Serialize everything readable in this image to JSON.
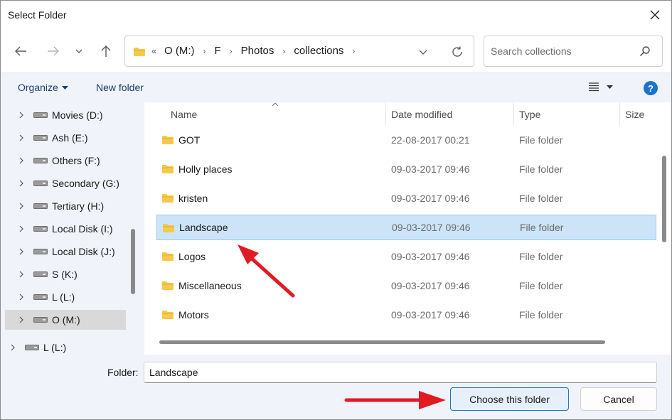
{
  "window": {
    "title": "Select Folder"
  },
  "nav": {
    "back_icon": "arrow-left-icon",
    "forward_icon": "arrow-right-icon",
    "recent_icon": "chevron-down-icon",
    "up_icon": "arrow-up-icon"
  },
  "address": {
    "overflow": "«",
    "crumbs": [
      "O (M:)",
      "F",
      "Photos",
      "collections"
    ]
  },
  "search": {
    "placeholder": "Search collections"
  },
  "commands": {
    "organize": "Organize",
    "new_folder": "New folder",
    "help": "?"
  },
  "sidebar": {
    "items": [
      {
        "label": "Movies (D:)"
      },
      {
        "label": "Ash (E:)"
      },
      {
        "label": "Others (F:)"
      },
      {
        "label": "Secondary (G:)"
      },
      {
        "label": "Tertiary (H:)"
      },
      {
        "label": "Local Disk (I:)"
      },
      {
        "label": "Local Disk (J:)"
      },
      {
        "label": "S (K:)"
      },
      {
        "label": "L (L:)"
      },
      {
        "label": "O (M:)"
      },
      {
        "label": "L (L:)"
      }
    ],
    "selected": "O (M:)"
  },
  "columns": {
    "name": "Name",
    "date": "Date modified",
    "type": "Type",
    "size": "Size"
  },
  "files": [
    {
      "name": "GOT",
      "date": "22-08-2017 00:21",
      "type": "File folder"
    },
    {
      "name": "Holly places",
      "date": "09-03-2017 09:46",
      "type": "File folder"
    },
    {
      "name": "kristen",
      "date": "09-03-2017 09:46",
      "type": "File folder"
    },
    {
      "name": "Landscape",
      "date": "09-03-2017 09:46",
      "type": "File folder"
    },
    {
      "name": "Logos",
      "date": "09-03-2017 09:46",
      "type": "File folder"
    },
    {
      "name": "Miscellaneous",
      "date": "09-03-2017 09:46",
      "type": "File folder"
    },
    {
      "name": "Motors",
      "date": "09-03-2017 09:46",
      "type": "File folder"
    }
  ],
  "selected_file": "Landscape",
  "footer": {
    "folder_label": "Folder:",
    "folder_value": "Landscape",
    "choose_label": "Choose this folder",
    "cancel_label": "Cancel"
  },
  "colors": {
    "accent": "#1a73d0",
    "selection": "#cce4f7",
    "folder": "#f7c84b",
    "annotation_arrow": "#e01b24"
  }
}
